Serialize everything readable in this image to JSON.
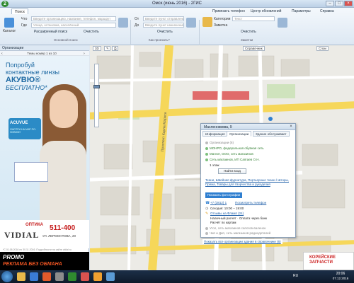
{
  "window": {
    "title": "Омск (июнь 2016) - 2ГИС"
  },
  "ribbon": {
    "tab_search": "Поиск",
    "links": {
      "print_phone": "Привязать телефон",
      "update_center": "Центр обновлений",
      "params": "Параметры",
      "help": "Справка"
    },
    "catalog": "Каталог",
    "what_label": "Что",
    "what_placeholder": "Введите организацию, название, телефон, маршрут",
    "where_label": "Где",
    "where_placeholder": "Улица, остановка, населённый",
    "extended_search": "Расширенный поиск",
    "clear": "Очистить",
    "group_main_search": "Основной поиск",
    "from_label": "От",
    "to_label": "До",
    "from_placeholder": "Введите пункт отправления",
    "to_placeholder": "Введите пункт назначения",
    "clear2": "Очистить",
    "group_route": "Как проехать?",
    "categories": "Категории",
    "note": "Заметка",
    "search_placeholder": "Текст",
    "clear3": "Очистить",
    "group_notes": "Заметки"
  },
  "left_panel": {
    "title": "Организации",
    "subtitle": "Темы номер 1 из 10",
    "ad": {
      "line1": "Попробуй",
      "line2": "контактные линзы",
      "line3": "АКУВЮ®",
      "line4": "БЕСПЛАТНО*",
      "box_label": "ACUVUE",
      "box_sub": "СМОТРИ НА МИР ПО-НОВОМУ",
      "optika": "ОПТИКА",
      "logo": "VIDIAL",
      "phone": "511-400",
      "address": "УЛ. ЛЕРМОНТОВА, 20",
      "small1": "*С 01.06.2016 по 30.11.2016. Подробности на сайте vidial.ru",
      "small2": "ЕСТЬ ПРОТИВОПОКАЗАНИЯ, ПРОКОНСУЛЬТИРУЙТЕСЬ С ВРАЧОМ"
    }
  },
  "map": {
    "tool_3d": "3D",
    "tool_reference": "Справочник",
    "tool_layers": "Слои",
    "road_label": "Проспект Карла Маркса"
  },
  "popup": {
    "title": "Масленникова, 9",
    "tabs": [
      "Информация",
      "Организации",
      "Здание обслуживает"
    ],
    "section_orgs": "Организации (6)",
    "org_line1": "МОНРО, федеральная обувная сеть",
    "org_line2": "Магнит, ООО, сеть магазинов",
    "org_line3": "Сеть магазинов, ИП Сапгаев О.Н.",
    "floor": "1 этаж",
    "enter_button": "Найти вход",
    "categories": "Ткани, Швейная фурнитура, Портьерные ткани / Шторы, Пряжа, Товары для творчества и рукоделия",
    "show_photos": "Показать фотографии",
    "phone": "+7 (3812) 1",
    "show_phone": "Посмотреть телефон",
    "hours": "Сегодня: 10:00 – 19:00",
    "reviews": "Отзывы на Фламп (24)",
    "payment": "Наличный расчёт · Оплата через банк",
    "payment2": "Расчёт по картам",
    "other1": "Угол, сеть магазинов сапогов-валенок",
    "other2": "Чип и Дип, сеть магазинов радиодеталей",
    "show_all": "Показать все организации здания в справочнике (6)"
  },
  "bottom_ad": {
    "brand": "PROMO",
    "slogan": "РЕКЛАМА БЕЗ ОБМАНА",
    "right": "КОРЕЙСКИЕ ЗАПЧАСТИ"
  },
  "taskbar": {
    "lang": "RU",
    "time": "20:06",
    "date": "07.12.2016"
  },
  "colors": {
    "ribbon_bg": "#dde8f3",
    "accent_blue": "#2f7fd0",
    "road_yellow": "#f6d75a",
    "ad_red": "#c51d1d"
  }
}
